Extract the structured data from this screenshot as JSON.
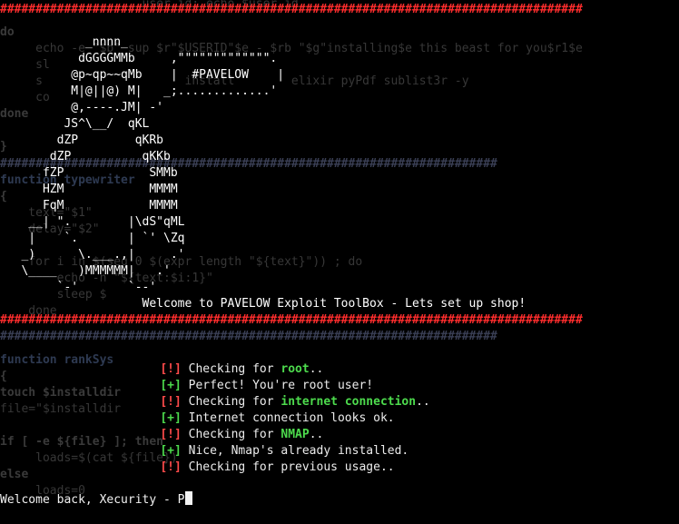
{
  "terminal": {
    "hash_line": "##################################################################################",
    "hash_line_mid": "######################################################################",
    "background_lines": [
      "                    user_id; echo $user_id",
      "do",
      "     echo -e \"$b\" sup $r\"$USERID\"$e - $rb \"$g\"installing$e this beast for you$r1$e",
      "     sl",
      "     s                    install        elixir pyPdf sublist3r -y",
      "     co",
      "done",
      "",
      "}",
      "",
      "function typewriter",
      "{",
      "    text=\"$1\"",
      "    delay=\"$2\"",
      "",
      "    for i in $(seq 0 $(expr length \"${text}\")) ; do",
      "        echo -n \"${text:$i:1}\"",
      "        sleep $",
      "    done",
      "",
      "",
      "function rankSys",
      "{",
      "touch $installdir",
      "file=\"$installdir",
      "",
      "if [ -e ${file} ]; then",
      "     loads=$(cat ${file})",
      "else",
      "     loads=0"
    ],
    "art_lines": [
      "            _nnnn_",
      "           dGGGGMMb     ,\"\"\"\"\"\"\"\"\"\"\"\"\".",
      "          @p~qp~~qMb    |  #PAVELOW    |",
      "          M|@||@) M|   _;.............'",
      "          @,----.JM| -'",
      "         JS^\\__/  qKL",
      "        dZP        qKRb",
      "       dZP          qKKb",
      "      fZP            SMMb",
      "      HZM            MMMM",
      "      FqM            MMMM",
      "    __| \".        |\\dS\"qML",
      "    |    `.       | `' \\Zq",
      "   _)      \\.___.,|     .'",
      "   \\____   )MMMMMM|   .'",
      "        `-'       `--'"
    ],
    "welcome": "                    Welcome to PAVELOW Exploit ToolBox - Lets set up shop!",
    "messages": [
      {
        "tag": "[!]",
        "pre": "Checking for ",
        "hl": "root",
        "post": ".."
      },
      {
        "tag": "[+]",
        "pre": "Perfect! You're root user!",
        "hl": "",
        "post": ""
      },
      {
        "tag": "[!]",
        "pre": "Checking for ",
        "hl": "internet connection",
        "post": ".."
      },
      {
        "tag": "[+]",
        "pre": "Internet connection looks ok.",
        "hl": "",
        "post": ""
      },
      {
        "tag": "[!]",
        "pre": "Checking for ",
        "hl": "NMAP",
        "post": ".."
      },
      {
        "tag": "[+]",
        "pre": "Nice, Nmap's already installed.",
        "hl": "",
        "post": ""
      },
      {
        "tag": "[!]",
        "pre": "Checking for previous usage..",
        "hl": "",
        "post": ""
      }
    ],
    "prompt_text": "Welcome back, Xecurity - P",
    "colors": {
      "background": "#000000",
      "warn_tag": "#ff4b4b",
      "ok_tag": "#4ddb4d",
      "highlight": "#4ddb4d",
      "hash": "#ff2d2d"
    }
  }
}
